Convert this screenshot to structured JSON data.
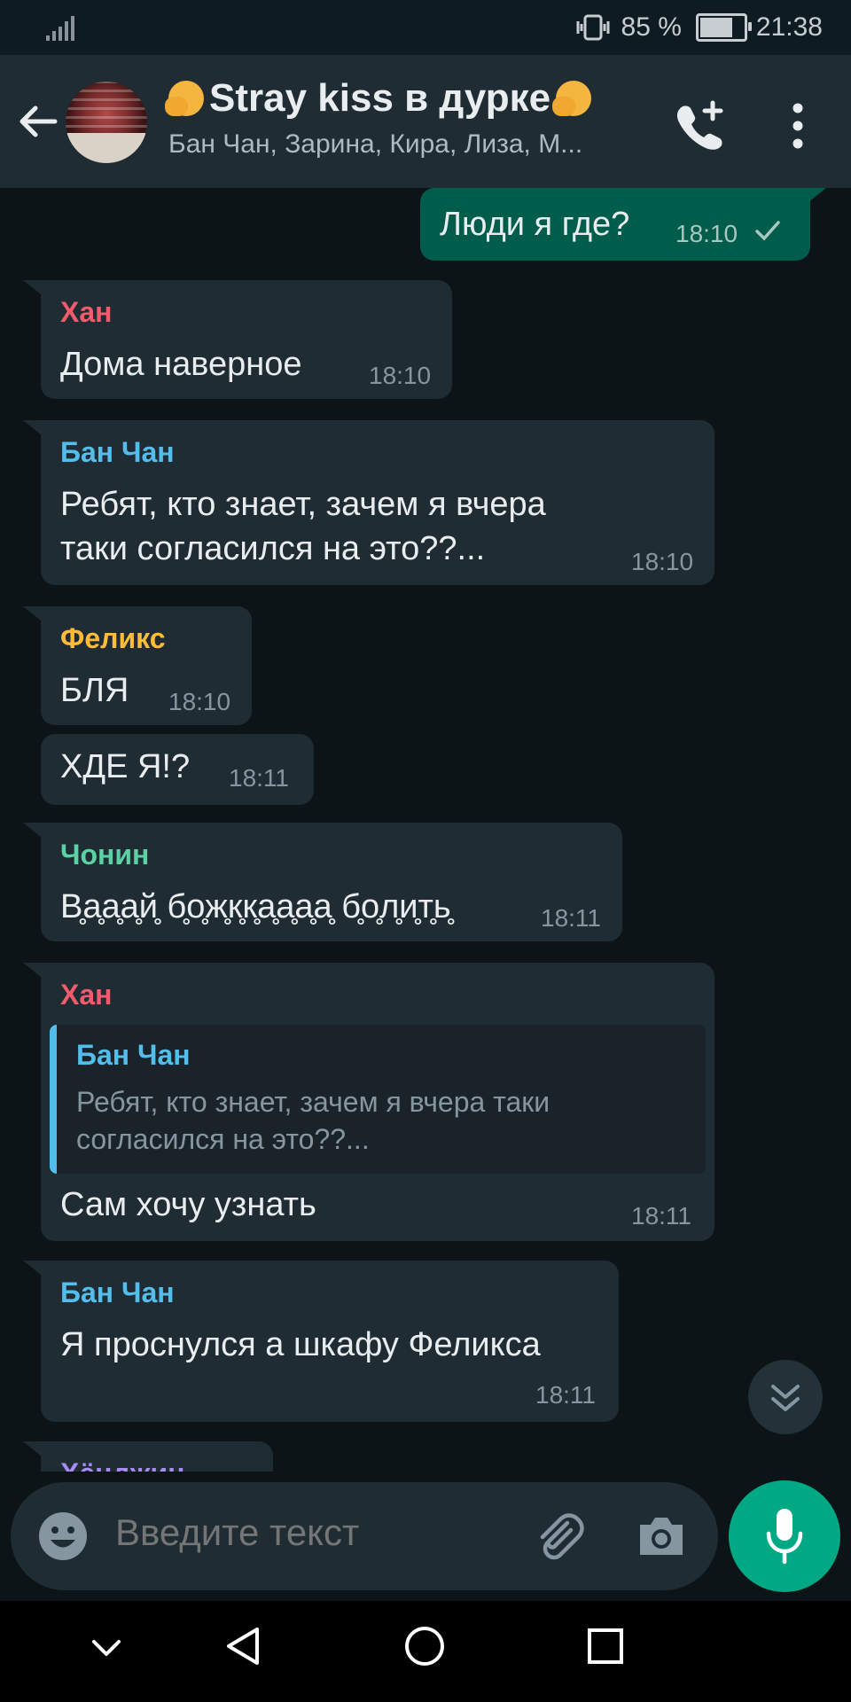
{
  "status_bar": {
    "battery": "85 %",
    "time": "21:38",
    "battery_level": 0.85
  },
  "chat": {
    "title": "Stray kiss в дурке",
    "members": "Бан Чан, Зарина, Кира, Лиза, М..."
  },
  "messages": [
    {
      "direction": "out",
      "text": "Люди я где?",
      "time": "18:10",
      "status": "sent"
    },
    {
      "sender": "Хан",
      "sender_color": "#f15c6d",
      "text": "Дома наверное",
      "time": "18:10"
    },
    {
      "sender": "Бан Чан",
      "sender_color": "#53bdeb",
      "text_line1": "Ребят,  кто знает,  зачем я вчера",
      "text_line2": "таки согласился на это??...",
      "time": "18:10"
    },
    {
      "sender": "Феликс",
      "sender_color": "#ffbc38",
      "text": "БЛЯ",
      "time": "18:10"
    },
    {
      "sender": "Феликс",
      "text": "ХДЕ Я!?",
      "time": "18:11"
    },
    {
      "sender": "Чонин",
      "sender_color": "#5bd2a3",
      "text": "В̥а̥а̥а̥й̥ б̥о̥ж̥к̥к̥а̥а̥а̥а̥ б̥о̥л̥и̥т̥ь̥",
      "time": "18:11"
    },
    {
      "sender": "Хан",
      "sender_color": "#f15c6d",
      "quote": {
        "sender": "Бан Чан",
        "line1": "Ребят,  кто знает,  зачем я вчера таки",
        "line2": "согласился на это??..."
      },
      "text": "Сам хочу узнать",
      "time": "18:11"
    },
    {
      "sender": "Бан Чан",
      "sender_color": "#53bdeb",
      "text": "Я проснулся а шкафу Феликса",
      "time": "18:11"
    },
    {
      "sender": "Хёнджин",
      "sender_color": "#a98bf5"
    }
  ],
  "composer": {
    "placeholder": "Введите текст"
  },
  "icons": {
    "back": "arrow-left-icon",
    "call": "add-call-icon",
    "menu": "kebab-menu-icon",
    "emoji": "emoji-icon",
    "attach": "paperclip-icon",
    "camera": "camera-icon",
    "mic": "microphone-icon",
    "scroll": "double-chevron-down-icon"
  },
  "colors": {
    "accent": "#00a884",
    "outgoing_bubble": "#005c4b",
    "incoming_bubble": "#202c33",
    "background": "#0d1418"
  }
}
